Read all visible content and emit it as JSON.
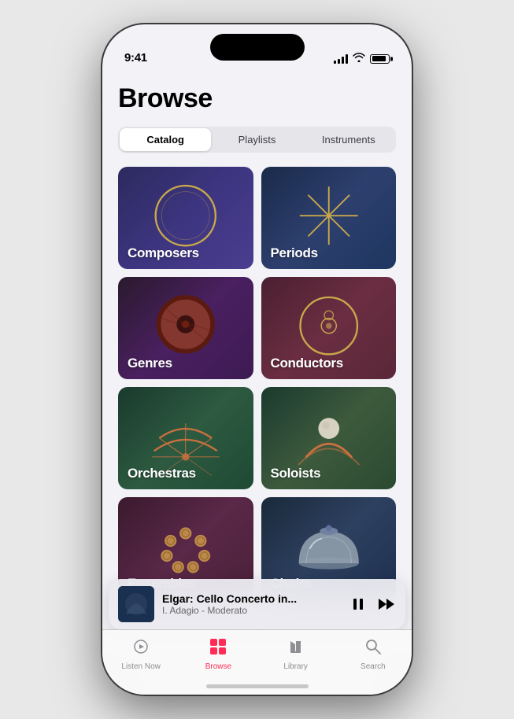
{
  "statusBar": {
    "time": "9:41"
  },
  "page": {
    "title": "Browse"
  },
  "segmentedControl": {
    "tabs": [
      {
        "label": "Catalog",
        "active": true
      },
      {
        "label": "Playlists",
        "active": false
      },
      {
        "label": "Instruments",
        "active": false
      }
    ]
  },
  "grid": {
    "items": [
      {
        "id": "composers",
        "label": "Composers"
      },
      {
        "id": "periods",
        "label": "Periods"
      },
      {
        "id": "genres",
        "label": "Genres"
      },
      {
        "id": "conductors",
        "label": "Conductors"
      },
      {
        "id": "orchestras",
        "label": "Orchestras"
      },
      {
        "id": "soloists",
        "label": "Soloists"
      },
      {
        "id": "ensembles",
        "label": "Ensembles"
      },
      {
        "id": "choirs",
        "label": "Choirs"
      }
    ]
  },
  "miniPlayer": {
    "title": "Elgar: Cello Concerto in...",
    "subtitle": "I. Adagio - Moderato"
  },
  "tabBar": {
    "items": [
      {
        "label": "Listen Now",
        "icon": "▶",
        "active": false
      },
      {
        "label": "Browse",
        "icon": "⊞",
        "active": true
      },
      {
        "label": "Library",
        "icon": "♪",
        "active": false
      },
      {
        "label": "Search",
        "icon": "⌕",
        "active": false
      }
    ]
  }
}
